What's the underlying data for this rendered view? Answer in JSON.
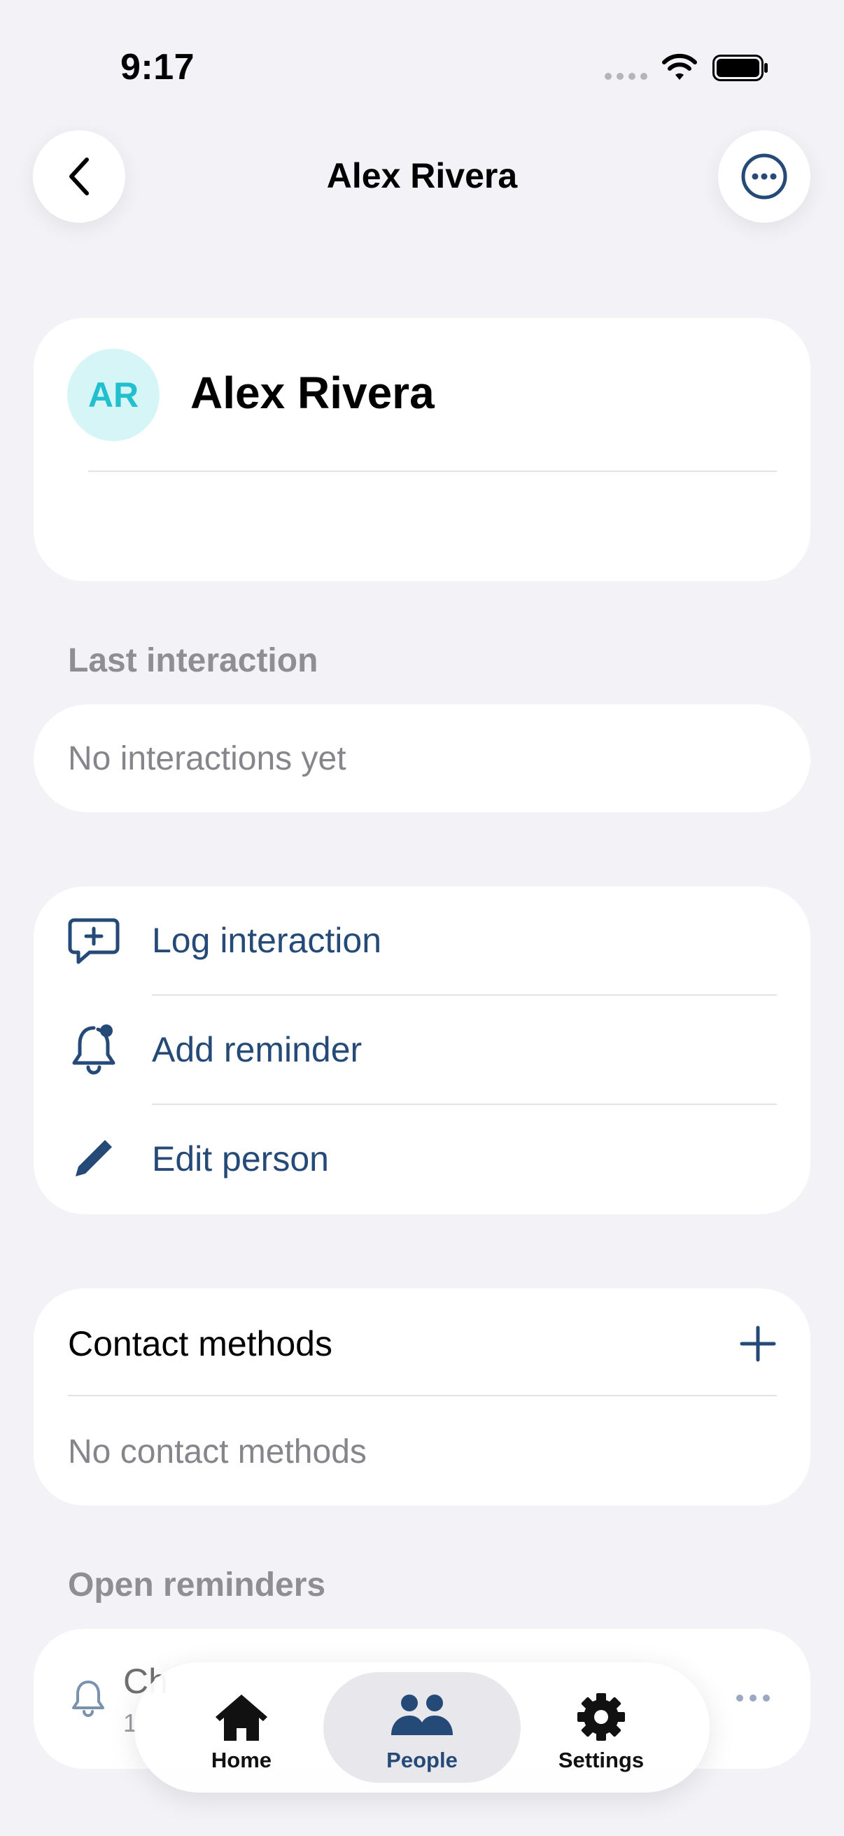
{
  "status_bar": {
    "time": "9:17"
  },
  "nav": {
    "title": "Alex Rivera"
  },
  "profile": {
    "initials": "AR",
    "name": "Alex Rivera"
  },
  "last_interaction": {
    "label": "Last interaction",
    "empty_text": "No interactions yet"
  },
  "actions": {
    "log_interaction": "Log interaction",
    "add_reminder": "Add reminder",
    "edit_person": "Edit person"
  },
  "contact_methods": {
    "title": "Contact methods",
    "empty_text": "No contact methods"
  },
  "open_reminders": {
    "label": "Open reminders",
    "item_title_visible": "Ch",
    "item_subtitle_visible": "1"
  },
  "tabbar": {
    "tabs": [
      {
        "label": "Home",
        "icon": "house-icon",
        "active": false
      },
      {
        "label": "People",
        "icon": "people-icon",
        "active": true
      },
      {
        "label": "Settings",
        "icon": "gear-icon",
        "active": false
      }
    ]
  },
  "colors": {
    "background": "#f2f2f7",
    "accent": "#254a78",
    "avatar_bg": "#d6f5f7",
    "avatar_text": "#22bfcf",
    "muted": "#8e8e93"
  }
}
